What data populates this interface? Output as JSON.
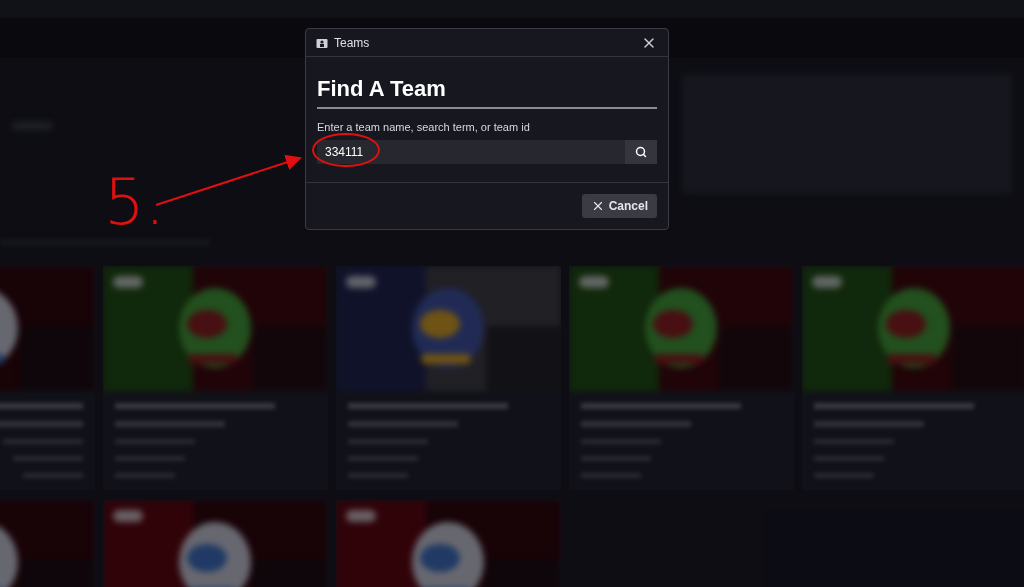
{
  "dialog": {
    "title": "Teams",
    "heading": "Find A Team",
    "field_label": "Enter a team name, search term, or team id",
    "search_field": {
      "value": "334111"
    },
    "cancel_button": "Cancel"
  },
  "annotation": {
    "label": "5."
  }
}
